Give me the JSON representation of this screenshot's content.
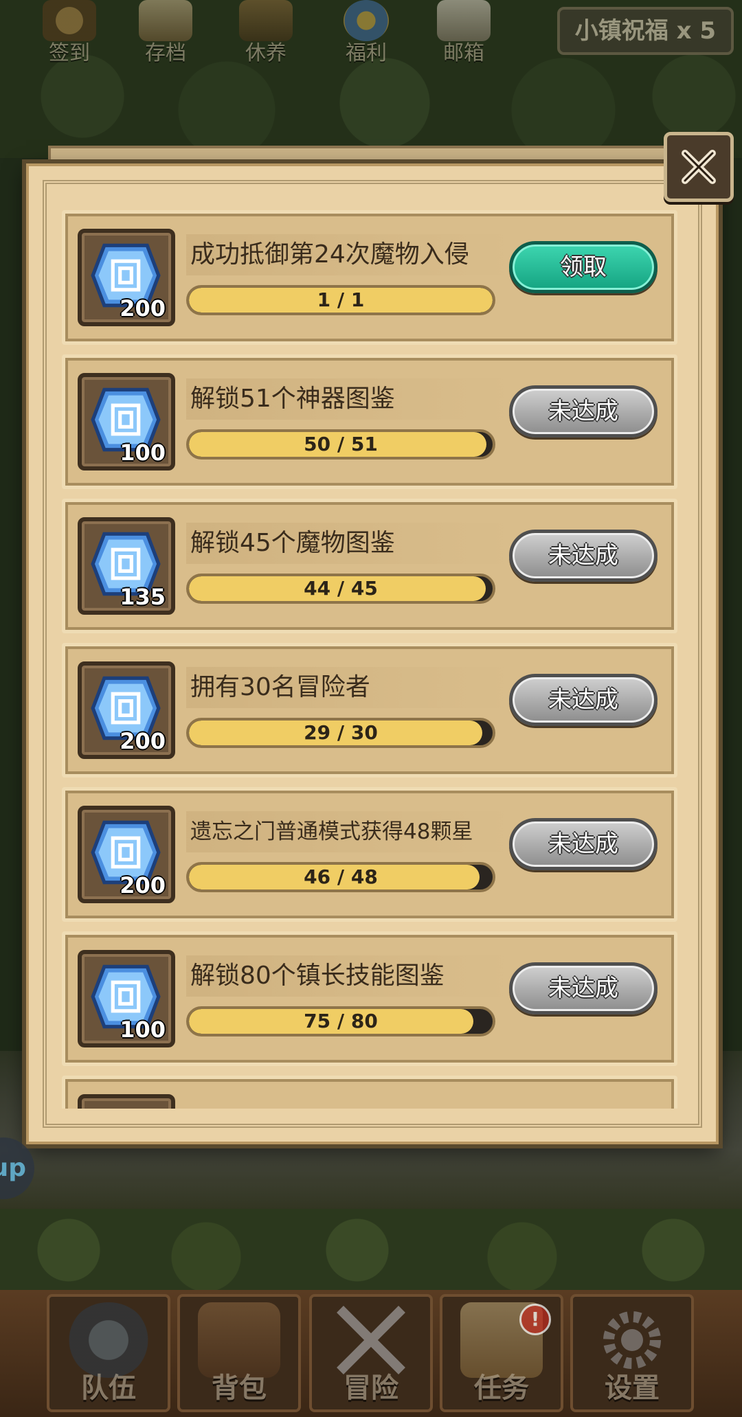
{
  "top_menu": [
    {
      "label": "签到",
      "icon": "sign-in-icon"
    },
    {
      "label": "存档",
      "icon": "save-scroll-icon"
    },
    {
      "label": "休养",
      "icon": "rest-icon"
    },
    {
      "label": "福利",
      "icon": "welfare-shield-icon"
    },
    {
      "label": "邮箱",
      "icon": "mailbox-icon"
    }
  ],
  "blessing": {
    "label": "小镇祝福 x 5"
  },
  "achievements": [
    {
      "title": "成功抵御第24次魔物入侵",
      "reward": "200",
      "progress_text": "1 / 1",
      "progress": 1.0,
      "status": "claim",
      "button": "领取"
    },
    {
      "title": "解锁51个神器图鉴",
      "reward": "100",
      "progress_text": "50 / 51",
      "progress": 0.98,
      "status": "pending",
      "button": "未达成"
    },
    {
      "title": "解锁45个魔物图鉴",
      "reward": "135",
      "progress_text": "44 / 45",
      "progress": 0.978,
      "status": "pending",
      "button": "未达成"
    },
    {
      "title": "拥有30名冒险者",
      "reward": "200",
      "progress_text": "29 / 30",
      "progress": 0.967,
      "status": "pending",
      "button": "未达成"
    },
    {
      "title": "遗忘之门普通模式获得48颗星",
      "reward": "200",
      "progress_text": "46 / 48",
      "progress": 0.958,
      "status": "pending",
      "button": "未达成"
    },
    {
      "title": "解锁80个镇长技能图鉴",
      "reward": "100",
      "progress_text": "75 / 80",
      "progress": 0.9375,
      "status": "pending",
      "button": "未达成"
    }
  ],
  "side_bubble": {
    "label": "up"
  },
  "bottom_nav": [
    {
      "label": "队伍",
      "icon": "helmet-icon"
    },
    {
      "label": "背包",
      "icon": "backpack-icon"
    },
    {
      "label": "冒险",
      "icon": "crossed-swords-icon"
    },
    {
      "label": "任务",
      "icon": "quest-scroll-icon",
      "badge": "!"
    },
    {
      "label": "设置",
      "icon": "gear-icon"
    }
  ],
  "colors": {
    "parchment": "#ead2a6",
    "row_bg": "#d9bd8b",
    "progress_fill": "#f0cd64",
    "claim_button": "#1fb892",
    "pending_button": "#a8a8a8",
    "gem_blue": "#5aa8f0"
  }
}
